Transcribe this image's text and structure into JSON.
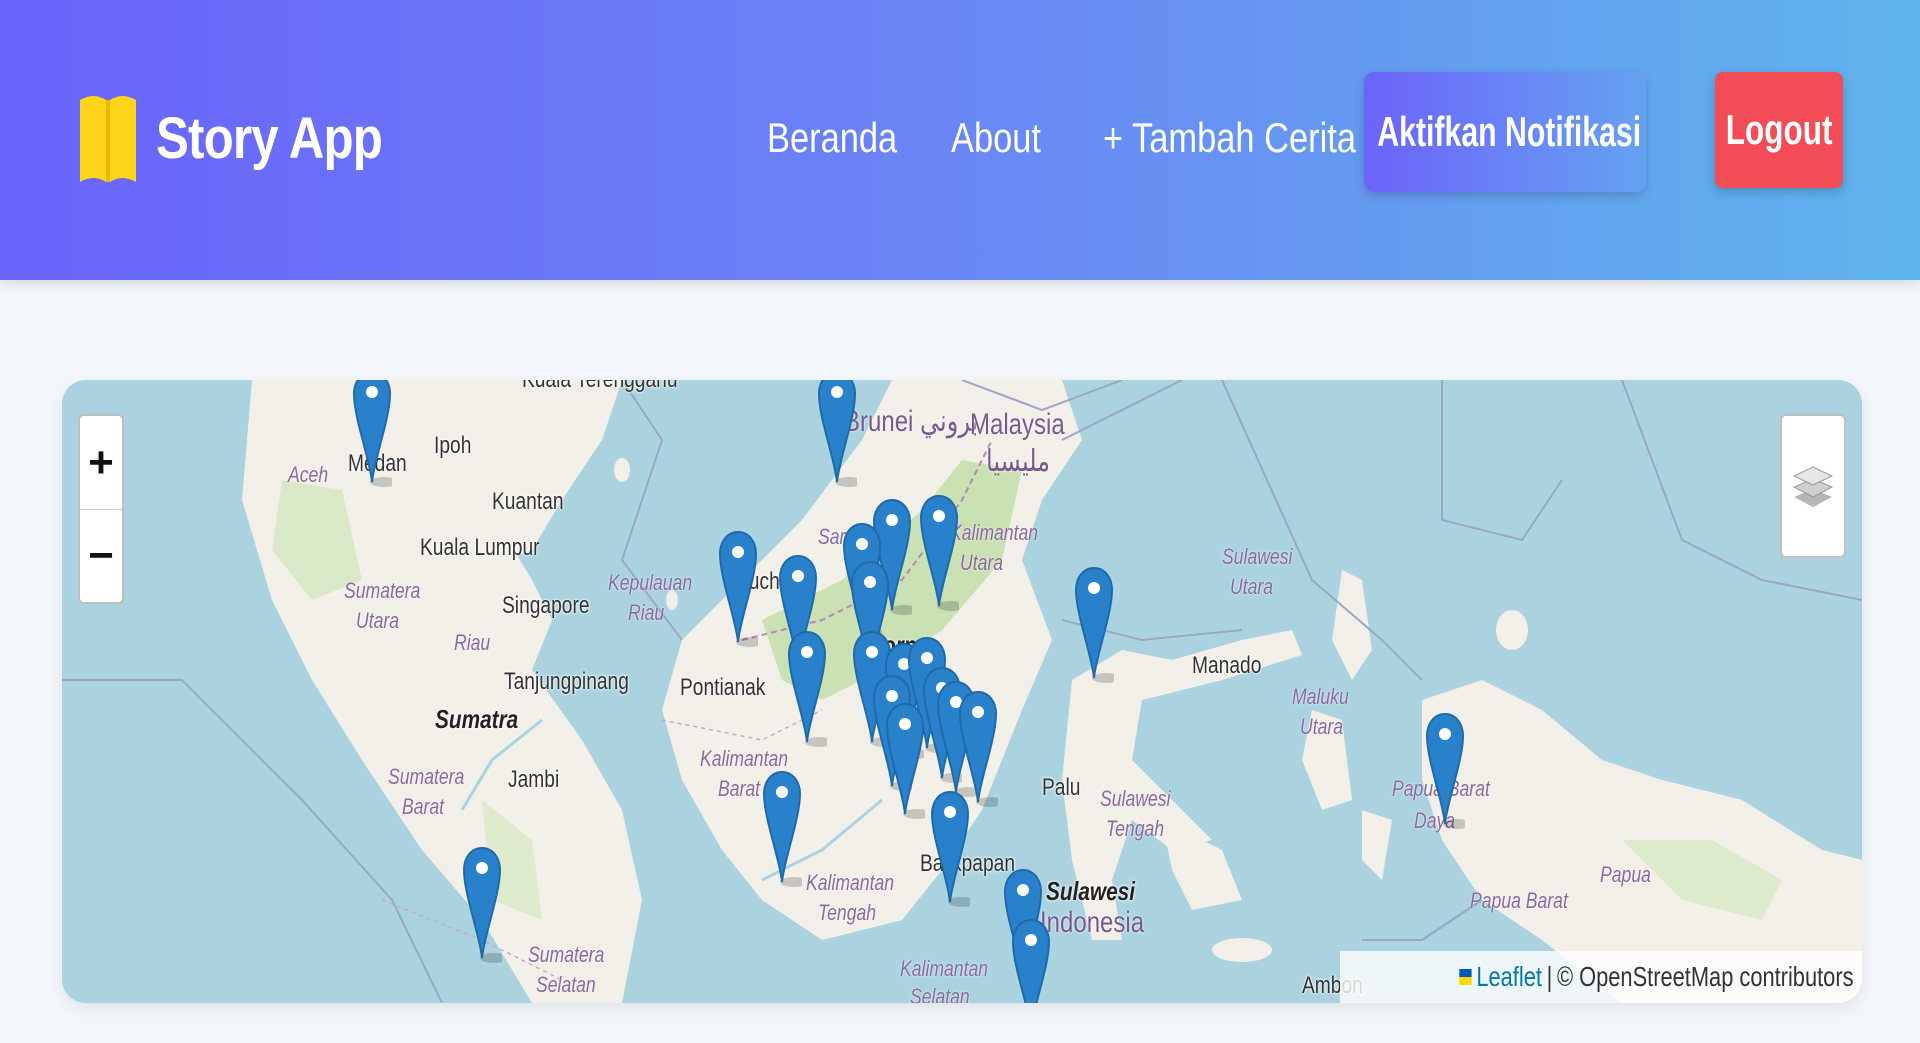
{
  "header": {
    "brand": "Story App",
    "nav": {
      "home": "Beranda",
      "about": "About",
      "add_story": "+ Tambah Cerita"
    },
    "notif_button": "Aktifkan Notifikasi",
    "logout_button": "Logout",
    "colors": {
      "gradient_start": "#6a63fb",
      "gradient_end": "#5fb4ec",
      "logout": "#f24c57",
      "logo": "#ffd51a"
    }
  },
  "map": {
    "zoom_in": "+",
    "zoom_out": "−",
    "attribution": {
      "leaflet": "Leaflet",
      "separator": "|",
      "osm": "© OpenStreetMap contributors"
    },
    "places": {
      "aceh": "Aceh",
      "medan": "Medan",
      "ipoh": "Ipoh",
      "kuantan": "Kuantan",
      "kuala_lumpur": "Kuala Lumpur",
      "sumatera_utara_1": "Sumatera",
      "sumatera_utara_2": "Utara",
      "riau": "Riau",
      "singapore": "Singapore",
      "kepulauan_riau_1": "Kepulauan",
      "kepulauan_riau_2": "Riau",
      "tanjungpinang": "Tanjungpinang",
      "sumatra": "Sumatra",
      "sumatera_barat_1": "Sumatera",
      "sumatera_barat_2": "Barat",
      "jambi": "Jambi",
      "sumatera_selatan_1": "Sumatera",
      "sumatera_selatan_2": "Selatan",
      "kuching": "Kuching",
      "pontianak": "Pontianak",
      "kalbar_1": "Kalimantan",
      "kalbar_2": "Barat",
      "kalteng_1": "Kalimantan",
      "kalteng_2": "Tengah",
      "kalsel_1": "Kalimantan",
      "kalsel_2": "Selatan",
      "sarawak": "Sarawak",
      "brunei": "Brunei بروني",
      "malaysia": "Malaysia",
      "malaysia_jawi": "مليسيا",
      "kaltara_1": "Kalimantan",
      "kaltara_2": "Utara",
      "borneo": "Borneo",
      "balikpapan": "Balikpapan",
      "palu": "Palu",
      "sulawesi_indonesia_1": "Sulawesi",
      "sulawesi_indonesia_2": "Indonesia",
      "sulteng_1": "Sulawesi",
      "sulteng_2": "Tengah",
      "sulut_1": "Sulawesi",
      "sulut_2": "Utara",
      "manado": "Manado",
      "malut_1": "Maluku",
      "malut_2": "Utara",
      "ambon": "Ambon",
      "papua_barat_daya_1": "Papua Barat",
      "papua_barat_daya_2": "Daya",
      "papua_barat": "Papua Barat",
      "papua": "Papua",
      "kuala_terengganu": "Kuala Terengganu"
    },
    "marker_count": 24
  }
}
